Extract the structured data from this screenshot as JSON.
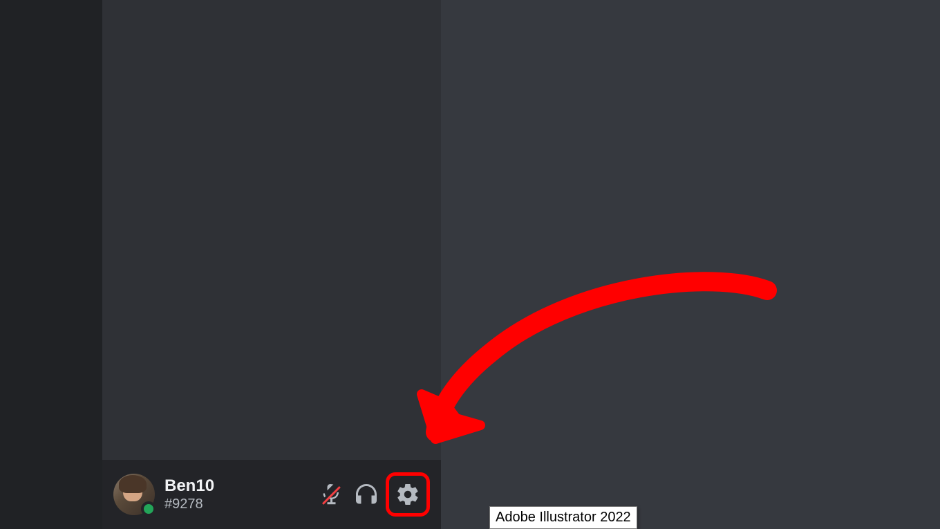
{
  "user": {
    "name": "Ben10",
    "discriminator": "#9278",
    "status": "online"
  },
  "controls": {
    "mic": "mute-microphone-icon",
    "deafen": "headphones-icon",
    "settings": "gear-icon"
  },
  "tooltip": "Adobe Illustrator 2022",
  "annotation": {
    "arrow_color": "#ff0000",
    "highlight_color": "#ff0000"
  }
}
